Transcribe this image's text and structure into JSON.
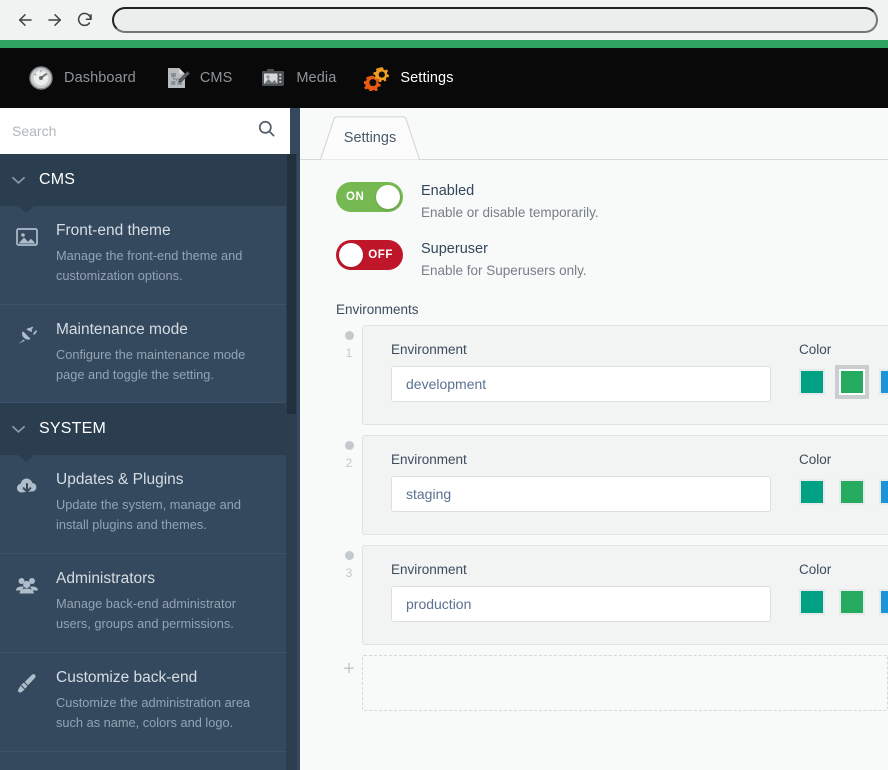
{
  "browser": {
    "back_icon": "arrow-left-icon",
    "forward_icon": "arrow-right-icon",
    "reload_icon": "reload-icon",
    "url_value": "",
    "accent_strip_color": "#2fa360"
  },
  "topnav": {
    "items": [
      {
        "label": "Dashboard",
        "icon": "gauge-icon",
        "active": false
      },
      {
        "label": "CMS",
        "icon": "document-pencil-icon",
        "active": false
      },
      {
        "label": "Media",
        "icon": "image-camera-icon",
        "active": false
      },
      {
        "label": "Settings",
        "icon": "gears-icon",
        "active": true
      }
    ],
    "background_color": "#090909",
    "inactive_label_color": "#8e9599",
    "active_label_color": "#ffffff"
  },
  "sidebar": {
    "search": {
      "placeholder": "Search",
      "value": "",
      "icon": "search-icon"
    },
    "groups": [
      {
        "label": "CMS",
        "chevron": "chevron-down-icon",
        "items": [
          {
            "title": "Front-end theme",
            "desc": "Manage the front-end theme and customization options.",
            "icon": "image-icon"
          },
          {
            "title": "Maintenance mode",
            "desc": "Configure the maintenance mode page and toggle the setting.",
            "icon": "plug-icon"
          }
        ]
      },
      {
        "label": "SYSTEM",
        "chevron": "chevron-down-icon",
        "items": [
          {
            "title": "Updates & Plugins",
            "desc": "Update the system, manage and install plugins and themes.",
            "icon": "cloud-download-icon"
          },
          {
            "title": "Administrators",
            "desc": "Manage back-end administrator users, groups and permissions.",
            "icon": "users-icon"
          },
          {
            "title": "Customize back-end",
            "desc": "Customize the administration area such as name, colors and logo.",
            "icon": "brush-icon"
          }
        ]
      }
    ],
    "background_color": "#34495e",
    "group_header_color": "#2b3e50"
  },
  "main": {
    "tab": {
      "label": "Settings",
      "active": true
    },
    "toggles": [
      {
        "state_label": "ON",
        "state": "on",
        "label": "Enabled",
        "desc": "Enable or disable temporarily.",
        "color": "#76b852"
      },
      {
        "state_label": "OFF",
        "state": "off",
        "label": "Superuser",
        "desc": "Enable for Superusers only.",
        "color": "#bf1729"
      }
    ],
    "environments": {
      "section_label": "Environments",
      "env_field_label": "Environment",
      "color_field_label": "Color",
      "palette": [
        "#00a185",
        "#25ab60",
        "#1c94d8",
        "#9b59b6"
      ],
      "items": [
        {
          "number": "1",
          "value": "development",
          "selected_color_index": 1
        },
        {
          "number": "2",
          "value": "staging",
          "selected_color_index": -1
        },
        {
          "number": "3",
          "value": "production",
          "selected_color_index": -1
        }
      ],
      "add_label": "+"
    }
  }
}
